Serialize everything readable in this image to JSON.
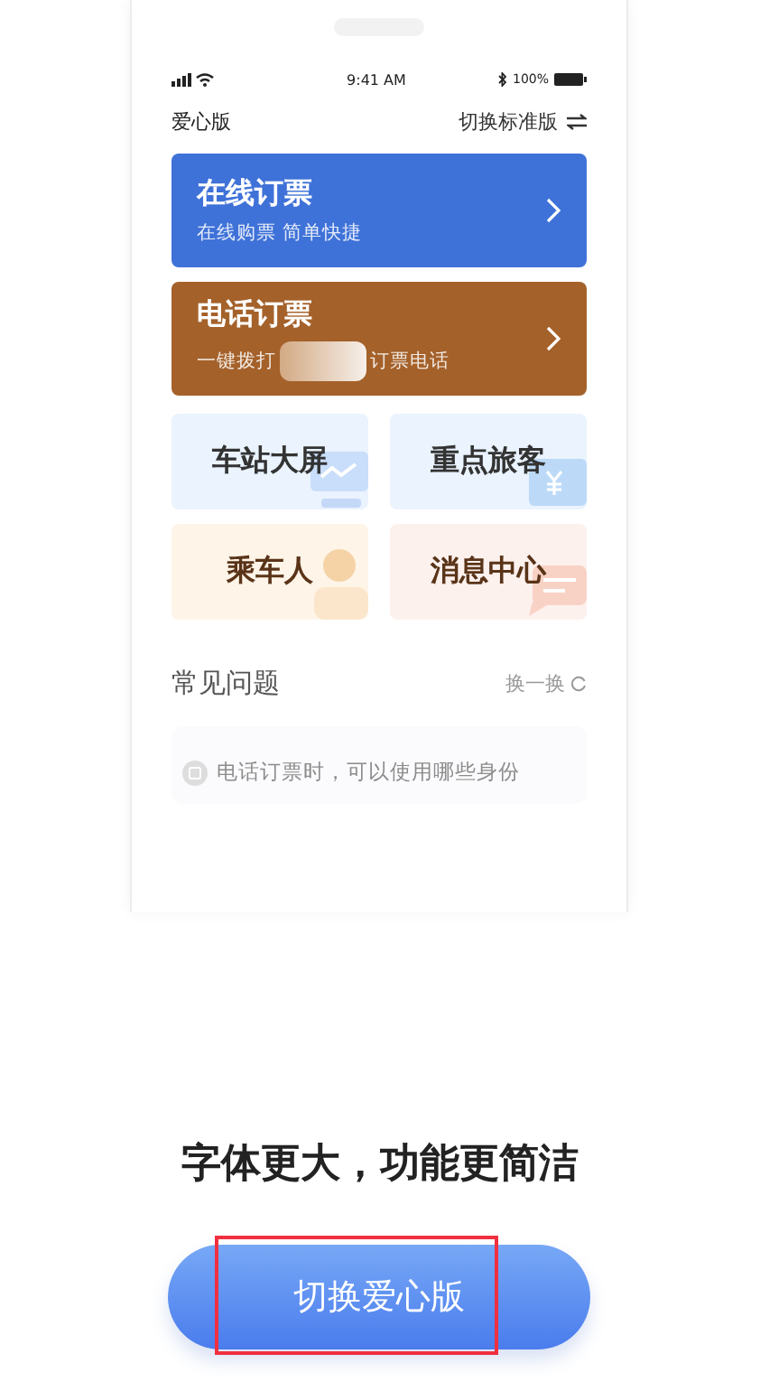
{
  "status_bar": {
    "time": "9:41 AM",
    "battery": "100%"
  },
  "header": {
    "title": "爱心版",
    "switch_label": "切换标准版"
  },
  "cards": [
    {
      "title": "在线订票",
      "subtitle": [
        "在线购票 简单快捷"
      ],
      "color": "#3f72d8"
    },
    {
      "title": "电话订票",
      "subtitle": [
        "一键拨打",
        "订票电话"
      ],
      "color": "#a4612a"
    }
  ],
  "tiles": [
    {
      "label": "车站大屏",
      "kind": "screen"
    },
    {
      "label": "重点旅客",
      "kind": "money"
    },
    {
      "label": "乘车人",
      "kind": "person"
    },
    {
      "label": "消息中心",
      "kind": "message"
    }
  ],
  "faq": {
    "title": "常见问题",
    "refresh": "换一换",
    "items": [
      "电话订票时，可以使用哪些身份"
    ]
  },
  "caption": "字体更大，功能更简洁",
  "button": {
    "label": "切换爱心版",
    "highlighted": true
  }
}
